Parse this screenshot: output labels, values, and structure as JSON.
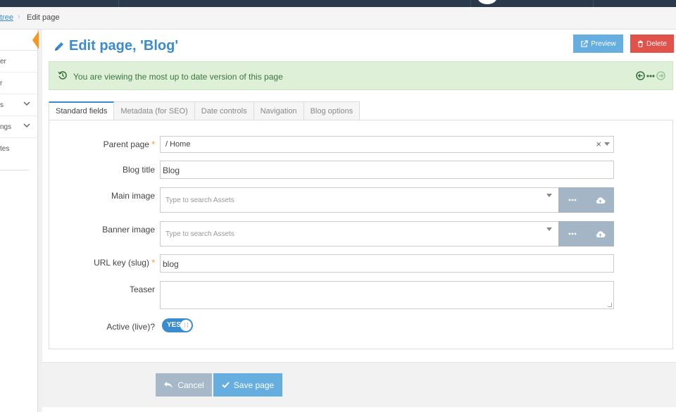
{
  "breadcrumb": {
    "link": "tree",
    "separator": "›",
    "current": "Edit page"
  },
  "sidebar": {
    "items": [
      {
        "label": "er",
        "has_chevron": false
      },
      {
        "label": "r",
        "has_chevron": false
      },
      {
        "label": "s",
        "has_chevron": true
      },
      {
        "label": "ngs",
        "has_chevron": true
      },
      {
        "label": "tes",
        "has_chevron": false
      }
    ]
  },
  "page": {
    "title": "Edit page, 'Blog'"
  },
  "actions": {
    "preview_label": "Preview",
    "delete_label": "Delete"
  },
  "notice": {
    "message": "You are viewing the most up to date version of this page"
  },
  "tabs": [
    {
      "label": "Standard fields",
      "active": true
    },
    {
      "label": "Metadata (for SEO)",
      "active": false
    },
    {
      "label": "Date controls",
      "active": false
    },
    {
      "label": "Navigation",
      "active": false
    },
    {
      "label": "Blog options",
      "active": false
    }
  ],
  "form": {
    "parent_page": {
      "label": "Parent page",
      "required_mark": "*",
      "value": "/ Home",
      "clear": "×"
    },
    "blog_title": {
      "label": "Blog title",
      "value": "Blog"
    },
    "main_image": {
      "label": "Main image",
      "placeholder": "Type to search Assets"
    },
    "banner_image": {
      "label": "Banner image",
      "placeholder": "Type to search Assets"
    },
    "url_key": {
      "label": "URL key (slug)",
      "required_mark": "*",
      "value": "blog"
    },
    "teaser": {
      "label": "Teaser",
      "value": ""
    },
    "active": {
      "label": "Active (live)?",
      "toggle_text": "YES",
      "value": true
    }
  },
  "footer": {
    "cancel_label": "Cancel",
    "save_label": "Save page"
  },
  "colors": {
    "accent": "#3a8ccf",
    "danger": "#e0524a",
    "success_bg": "#dff0d8",
    "required": "#f39a1e"
  }
}
